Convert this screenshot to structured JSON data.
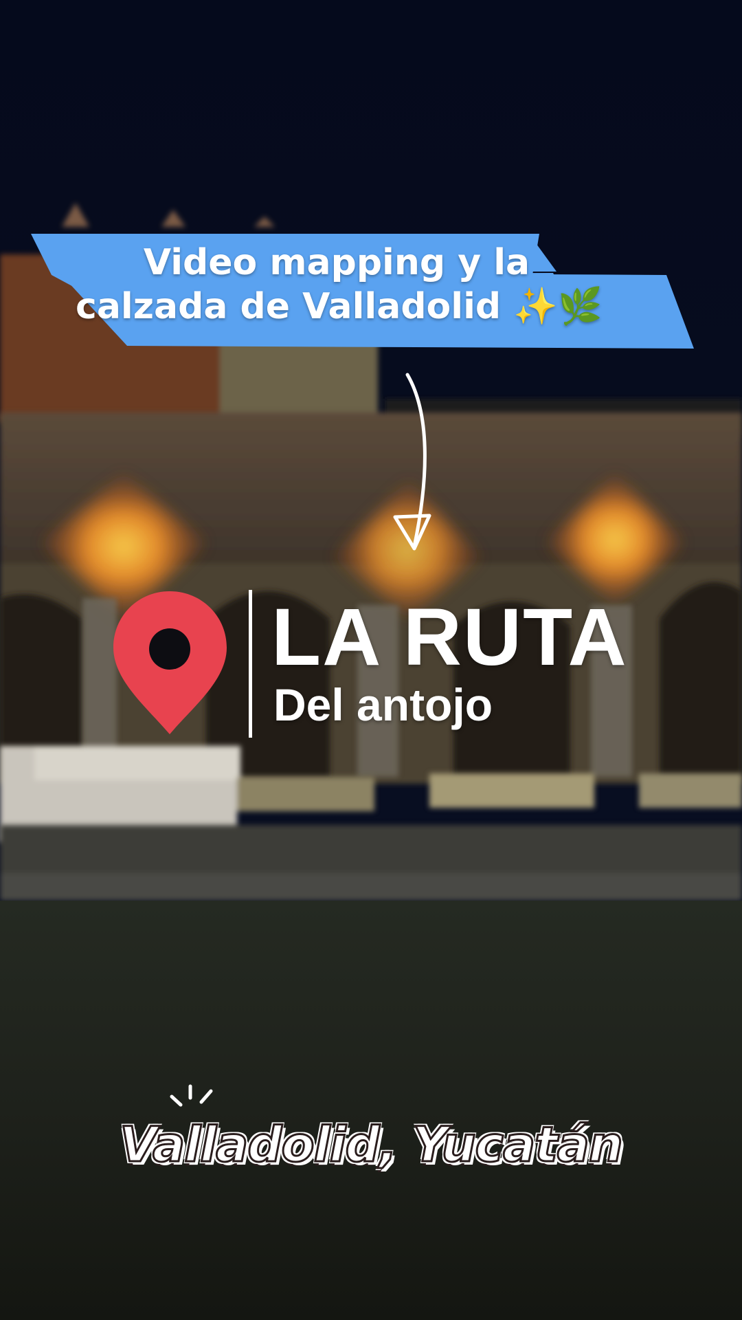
{
  "banner": {
    "line1": "Video mapping y la",
    "line2": "calzada de Valladolid ✨🌿",
    "color": "#5aa2f0"
  },
  "logo": {
    "title": "LA RUTA",
    "subtitle": "Del antojo",
    "pin_color": "#e8434f"
  },
  "caption": {
    "place": "Valladolid, Yucatán"
  }
}
